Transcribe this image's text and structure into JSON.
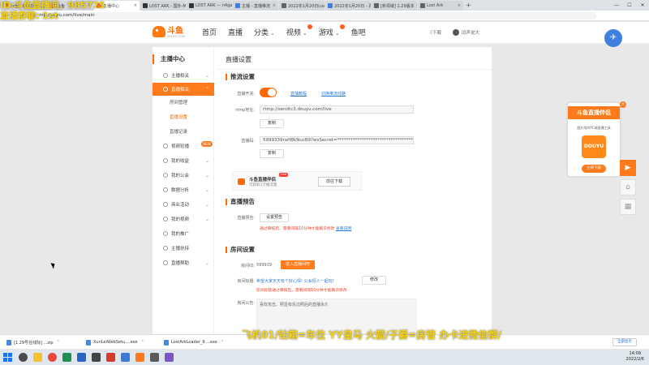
{
  "overlays": {
    "top_left_line1": "ID:斗鱼直播间，985775",
    "top_left_line2": "直播群聊: 1st",
    "bottom": "飞机01/钻箱=车位  YY皇马  火箭/子爵=房管    办卡进微信群/"
  },
  "browser": {
    "tabs": [
      {
        "title": "斗鱼 - DOUYU - 斗鱼",
        "color": "#ff7a1a",
        "active": false
      },
      {
        "title": "斗鱼",
        "color": "#ff7a1a",
        "active": false
      },
      {
        "title": "主播中心",
        "color": "#ff7a1a",
        "active": true
      },
      {
        "title": "LOST ARK - 国外-MMORPG",
        "color": "#333333",
        "active": false
      },
      {
        "title": "LOST ARK — n4gaming",
        "color": "#333333",
        "active": false
      },
      {
        "title": "主播 - 直播推流",
        "color": "#3e7fe0",
        "active": false
      },
      {
        "title": "2022年1月20日Lost Ark",
        "color": "#5f6368",
        "active": false
      },
      {
        "title": "2022年1月20日 - 百度",
        "color": "#3e7fe0",
        "active": false
      },
      {
        "title": "[新领域] 1.29版本",
        "color": "#5f6368",
        "active": false
      },
      {
        "title": "Lost Ark",
        "color": "#5f6368",
        "active": false
      }
    ],
    "url": "mp.douyu.com/live/main",
    "win_controls": [
      "—",
      "☐",
      "✕"
    ]
  },
  "site": {
    "logo_text": "斗鱼",
    "logo_sub": "DOUYU.COM",
    "nav": [
      {
        "label": "首页",
        "arrow": false,
        "dot": false
      },
      {
        "label": "直播",
        "arrow": false,
        "dot": false
      },
      {
        "label": "分类",
        "arrow": true,
        "dot": false
      },
      {
        "label": "视频",
        "arrow": true,
        "dot": true
      },
      {
        "label": "游戏",
        "arrow": true,
        "dot": true
      },
      {
        "label": "鱼吧",
        "arrow": false,
        "dot": false
      }
    ],
    "download_label": "下载",
    "username": "旧声说大"
  },
  "sidebar": {
    "title": "主播中心",
    "items": {
      "anchor_related": "主播相关",
      "live_related": "直播相关",
      "room_manage": "房间管理",
      "live_settings": "直播设置",
      "live_records": "直播记录",
      "video_carousel": "视频轮播",
      "my_earnings": "我的收益",
      "my_guild": "我的公会",
      "data_analysis": "数据分析",
      "business_events": "商业活动",
      "my_videos": "我的视频",
      "my_promotion": "我的推广",
      "anchor_support": "主播扶持",
      "live_help": "直播帮助"
    },
    "new_badge": "NEW"
  },
  "main": {
    "title": "直播设置",
    "push": {
      "section": "推流设置",
      "switch_label": "直播开关:",
      "link_settings": "直播教程",
      "link_switch": "切换推流线路",
      "rtmp_label": "rtmp地址:",
      "rtmp_value": "rtmp://sendtc3.douyu.com/live",
      "copy": "复制",
      "code_label": "直播码:",
      "code_value": "5999339raHBkNucB9?wsSecret=**********************************&wsT",
      "helper_title": "斗鱼直播伴侣",
      "helper_sub": "可获取1万播流量",
      "helper_new": "new",
      "helper_btn": "前往下载"
    },
    "notice": {
      "section": "直播预告",
      "label": "直播预告:",
      "btn": "设置预告",
      "warn": "通过审核后，需要间隔10分钟才能再次修改",
      "link": "查看说明"
    },
    "room": {
      "section": "房间设置",
      "id_label": "房间ID:",
      "id_value": "599939",
      "id_btn": "进入直播间吧",
      "title_label": "房间标题:",
      "title_value": "希望大家天天有个好心情! 公会招人一起玩!",
      "title_btn": "修改",
      "title_warn": "房间标题通过审核后，需要间隔10分钟才能再次修改",
      "announce_label": "房间公告:",
      "announce_value": "喜欢攻击、照显有反边照后的直播永久"
    }
  },
  "promo": {
    "header": "斗鱼直播伴侣",
    "sub": "超好用的PC端直播工具",
    "app": "DOUYU",
    "btn": "立即下载",
    "close": "×"
  },
  "floating": {
    "play": "▶",
    "home": "⌂",
    "qr": "▦",
    "bird": "✈"
  },
  "downloads": {
    "items": [
      "[1.29号在线际] ...zip",
      "XunLeiWebSetu....exe",
      "LostArkLoader_9....exe"
    ],
    "show_all": "全部显示"
  },
  "taskbar": {
    "time": "14:09",
    "date": "2022/2/6"
  }
}
